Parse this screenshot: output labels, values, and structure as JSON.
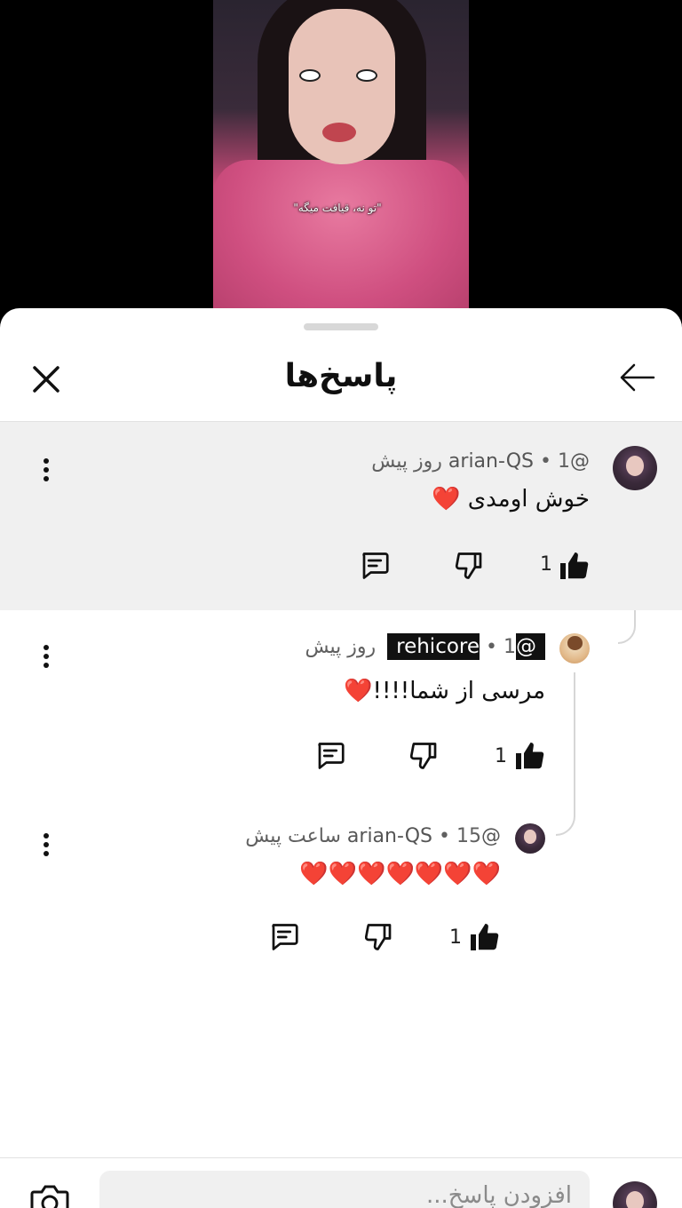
{
  "video": {
    "caption": "\"تو نه، قیافت میگه\""
  },
  "sheet": {
    "title": "پاسخ‌ها"
  },
  "comments": [
    {
      "author": "@arian-QS",
      "time": "1 روز پیش",
      "text": "خوش اومدی ❤️",
      "likes": "1",
      "highlighted": true
    },
    {
      "author": "@rehicore",
      "time": "1 روز پیش",
      "text": "مرسی از شما!!!!❤️",
      "likes": "1",
      "highlighted": false
    },
    {
      "author": "@arian-QS",
      "time": "15 ساعت پیش",
      "text": "❤️❤️❤️❤️❤️❤️❤️",
      "likes": "1",
      "highlighted": false
    }
  ],
  "composer": {
    "placeholder": "افزودن پاسخ..."
  },
  "icons": {
    "close": "close-icon",
    "back": "arrow-left-icon",
    "more": "more-vert-icon",
    "like": "thumbs-up-icon",
    "dislike": "thumbs-down-icon",
    "reply": "comment-icon",
    "camera": "camera-icon"
  },
  "colors": {
    "badge_bg": "#111111",
    "highlight_bg": "#f0f0f0"
  }
}
